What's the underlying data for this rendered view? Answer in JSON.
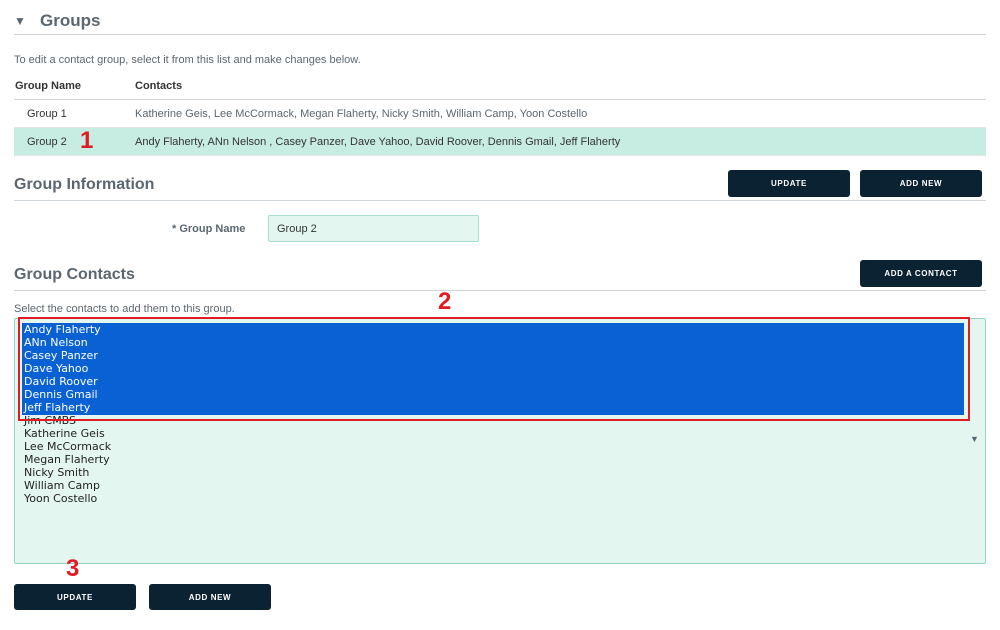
{
  "groups": {
    "caret": "▼",
    "title": "Groups",
    "hint": "To edit a contact group, select it from this list and make changes below.",
    "columns": {
      "name": "Group Name",
      "contacts": "Contacts"
    },
    "rows": [
      {
        "name": "Group 1",
        "contacts": "Katherine Geis, Lee McCormack, Megan Flaherty, Nicky Smith, William Camp, Yoon Costello",
        "selected": false
      },
      {
        "name": "Group 2",
        "contacts": "Andy Flaherty, ANn Nelson , Casey Panzer, Dave Yahoo, David Roover, Dennis Gmail, Jeff Flaherty",
        "selected": true
      }
    ]
  },
  "group_info": {
    "title": "Group Information",
    "update_label": "UPDATE",
    "add_new_label": "ADD NEW",
    "group_name_label": "* Group Name",
    "group_name_value": "Group 2"
  },
  "group_contacts": {
    "title": "Group Contacts",
    "add_contact_label": "ADD A CONTACT",
    "hint": "Select the contacts to add them to this group.",
    "options": [
      {
        "label": "Andy Flaherty",
        "selected": true
      },
      {
        "label": "ANn Nelson",
        "selected": true
      },
      {
        "label": "Casey Panzer",
        "selected": true
      },
      {
        "label": "Dave Yahoo",
        "selected": true
      },
      {
        "label": "David Roover",
        "selected": true
      },
      {
        "label": "Dennis Gmail",
        "selected": true
      },
      {
        "label": "Jeff Flaherty",
        "selected": true
      },
      {
        "label": "Jim CMBS",
        "selected": false
      },
      {
        "label": "Katherine Geis",
        "selected": false
      },
      {
        "label": "Lee McCormack",
        "selected": false
      },
      {
        "label": "Megan Flaherty",
        "selected": false
      },
      {
        "label": "Nicky Smith",
        "selected": false
      },
      {
        "label": "William Camp",
        "selected": false
      },
      {
        "label": "Yoon Costello",
        "selected": false
      }
    ],
    "arrow": "▼"
  },
  "footer": {
    "update_label": "UPDATE",
    "add_new_label": "ADD NEW"
  },
  "annotations": {
    "marker_1": "1",
    "marker_2": "2",
    "marker_3": "3",
    "color": "#e01b24"
  },
  "colors": {
    "selected_row": "#c7ede3",
    "button_bg": "#0b2232",
    "selection_blue": "#0a61d4",
    "field_bg": "#e3f6f0"
  }
}
